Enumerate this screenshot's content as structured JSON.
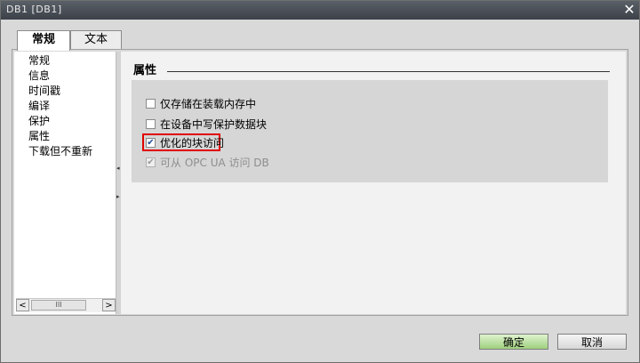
{
  "window": {
    "title": "DB1 [DB1]",
    "close_glyph": "✕"
  },
  "tabs": [
    {
      "label": "常规",
      "active": true
    },
    {
      "label": "文本",
      "active": false
    }
  ],
  "nav": {
    "items": [
      "常规",
      "信息",
      "时间戳",
      "编译",
      "保护",
      "属性",
      "下载但不重新"
    ],
    "selected": "属性",
    "scroll": {
      "left": "<",
      "right": ">",
      "thumb": "III"
    }
  },
  "splitter": {
    "up": "◂",
    "down": "▸"
  },
  "section": {
    "title": "属性",
    "options": [
      {
        "label": "仅存储在装载内存中",
        "checked": false,
        "disabled": false
      },
      {
        "label": "在设备中写保护数据块",
        "checked": false,
        "disabled": false
      },
      {
        "label": "优化的块访问",
        "checked": true,
        "disabled": false,
        "highlighted": true
      },
      {
        "label": "可从 OPC UA 访问 DB",
        "checked": true,
        "disabled": true
      }
    ]
  },
  "footer": {
    "ok_label": "确定",
    "cancel_label": "取消"
  },
  "colors": {
    "highlight": "#e00000",
    "ok_button": "#9fd07e"
  }
}
